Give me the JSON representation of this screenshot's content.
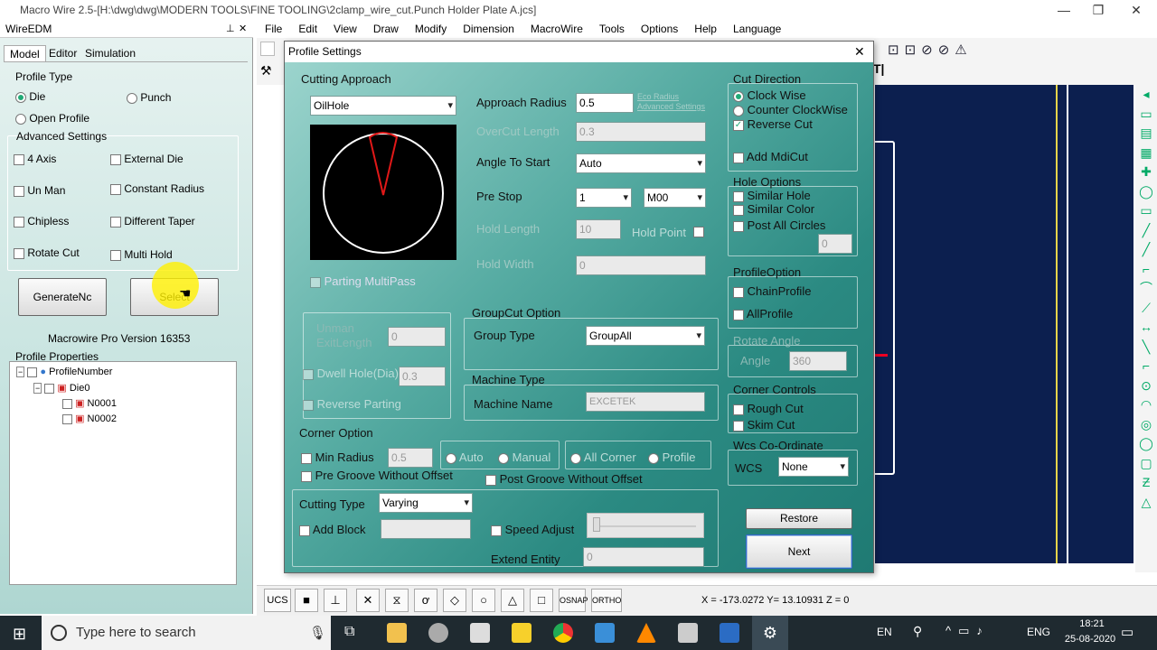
{
  "window": {
    "title": "Macro Wire 2.5-[H:\\dwg\\dwg\\MODERN TOOLS\\FINE TOOLING\\2clamp_wire_cut.Punch Holder Plate A.jcs]",
    "min": "—",
    "max": "❐",
    "close": "✕"
  },
  "menu": [
    "File",
    "Edit",
    "View",
    "Draw",
    "Modify",
    "Dimension",
    "MacroWire",
    "Tools",
    "Options",
    "Help",
    "Language"
  ],
  "left": {
    "panel_title": "WireEDM",
    "pin": "⊥",
    "close": "✕",
    "tabs": [
      "Model",
      "Editor",
      "Simulation"
    ],
    "profile_type_label": "Profile Type",
    "die": "Die",
    "punch": "Punch",
    "open_profile": "Open Profile",
    "advanced_label": "Advanced Settings",
    "opts": {
      "axis4": "4 Axis",
      "external_die": "External Die",
      "un_man": "Un Man",
      "constant_radius": "Constant Radius",
      "chipless": "Chipless",
      "different_taper": "Different Taper",
      "rotate_cut": "Rotate Cut",
      "multi_hold": "Multi Hold"
    },
    "generate_btn": "GenerateNc",
    "select_btn": "Select",
    "version": "Macrowire Pro Version 16353",
    "profile_props": "Profile Properties",
    "tree": {
      "root": "ProfileNumber",
      "die": "Die0",
      "n1": "N0001",
      "n2": "N0002"
    }
  },
  "dialog": {
    "title": "Profile Settings",
    "close": "✕",
    "cutting_approach": "Cutting Approach",
    "approach_type": "OilHole",
    "approach_radius_label": "Approach Radius",
    "approach_radius": "0.5",
    "eco_radius": "Eco Radius",
    "advanced_settings": "Advanced Settings",
    "overcut_label": "OverCut Length",
    "overcut": "0.3",
    "angle_label": "Angle To Start",
    "angle": "Auto",
    "prestop_label": "Pre Stop",
    "prestop": "1",
    "prestop_m": "M00",
    "hold_length_label": "Hold Length",
    "hold_length": "10",
    "hold_point": "Hold Point",
    "hold_width_label": "Hold Width",
    "hold_width": "0",
    "parting_multipass": "Parting MultiPass",
    "unman_exit": "Unman ExitLength",
    "unman_exit_val": "0",
    "dwell": "Dwell Hole(Dia)",
    "dwell_val": "0.3",
    "reverse_parting": "Reverse Parting",
    "groupcut": "GroupCut Option",
    "group_type_label": "Group Type",
    "group_type": "GroupAll",
    "machine_type": "Machine Type",
    "machine_name_label": "Machine  Name",
    "machine_name": "EXCETEK",
    "corner_option": "Corner Option",
    "min_radius": "Min Radius",
    "min_radius_val": "0.5",
    "auto": "Auto",
    "manual": "Manual",
    "all_corner": "All Corner",
    "profile": "Profile",
    "pre_groove": "Pre Groove Without Offset",
    "post_groove": "Post Groove Without Offset",
    "cutting_type_label": "Cutting Type",
    "cutting_type": "Varying",
    "add_block": "Add Block",
    "speed_adjust": "Speed Adjust",
    "extend_entity": "Extend Entity",
    "extend_val": "0",
    "cut_direction": "Cut Direction",
    "clockwise": "Clock Wise",
    "ccw": "Counter ClockWise",
    "reverse_cut": "Reverse Cut",
    "add_mdicut": "Add MdiCut",
    "hole_options": "Hole Options",
    "similar_hole": "Similar Hole",
    "similar_color": "Similar Color",
    "post_all": "Post All Circles",
    "hole_val": "0",
    "profile_option": "ProfileOption",
    "chain_profile": "ChainProfile",
    "all_profile": "AllProfile",
    "rotate_angle": "Rotate Angle",
    "angle_lbl": "Angle",
    "angle_val": "360",
    "corner_controls": "Corner Controls",
    "rough_cut": "Rough Cut",
    "skim_cut": "Skim Cut",
    "wcs_group": "Wcs Co-Ordinate",
    "wcs_label": "WCS",
    "wcs": "None",
    "restore": "Restore",
    "next": "Next"
  },
  "status": {
    "ucs": "UCS",
    "osnap": "OSNAP",
    "ortho": "ORTHO",
    "coords": "X = -173.0272  Y= 13.10931  Z = 0"
  },
  "taskbar": {
    "search": "Type here to search",
    "lang1": "EN",
    "lang2": "ENG",
    "time": "18:21",
    "date": "25-08-2020"
  }
}
